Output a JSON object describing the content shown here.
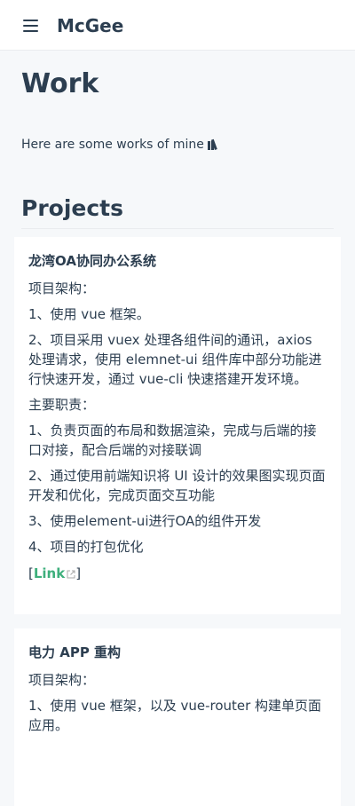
{
  "navbar": {
    "site_name": "McGee"
  },
  "page": {
    "title": "Work",
    "intro": "Here are some works of mine",
    "intro_icon": "books-icon"
  },
  "projects": {
    "heading": "Projects",
    "items": [
      {
        "title": "龙湾OA协同办公系统",
        "lines": [
          "项目架构：",
          "1、使用 vue 框架。",
          "2、项目采用 vuex 处理各组件间的通讯，axios 处理请求，使用 elemnet-ui 组件库中部分功能进行快速开发，通过 vue-cli 快速搭建开发环境。",
          "主要职责：",
          "1、负责页面的布局和数据渲染，完成与后端的接口对接，配合后端的对接联调",
          "2、通过使用前端知识将 UI 设计的效果图实现页面开发和优化，完成页面交互功能",
          "3、使用element-ui进行OA的组件开发",
          "4、项目的打包优化"
        ],
        "link_open": "[",
        "link_label": "Link",
        "link_close": "]"
      },
      {
        "title": "电力 APP 重构",
        "lines": [
          "项目架构：",
          "1、使用 vue 框架，以及 vue-router 构建单页面应用。"
        ]
      }
    ]
  },
  "colors": {
    "text": "#2c3e50",
    "accent": "#3eaf7c",
    "background": "#f6f8fa",
    "card": "#ffffff",
    "border": "#eaecef"
  }
}
